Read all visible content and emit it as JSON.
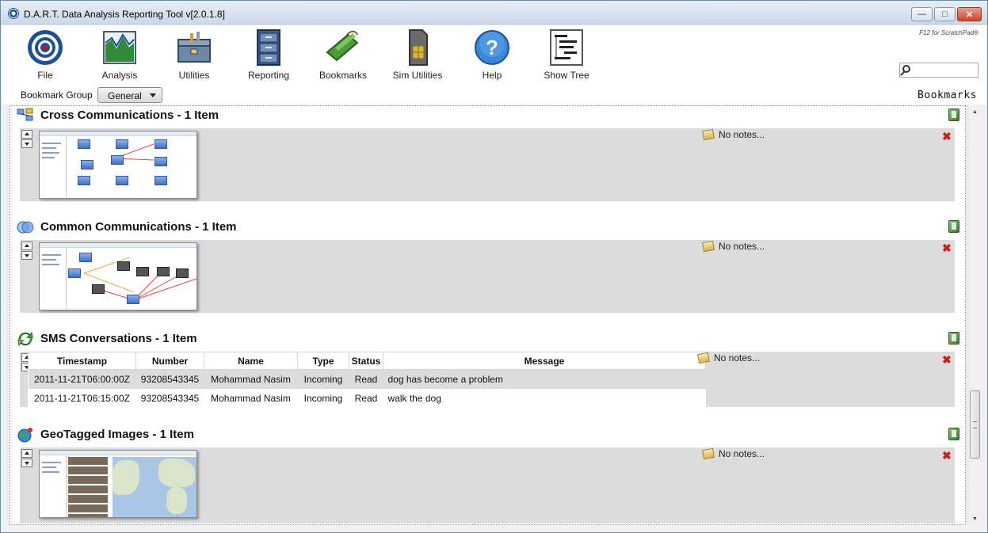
{
  "window": {
    "title": "D.A.R.T. Data Analysis Reporting Tool v[2.0.1.8]",
    "minimize_symbol": "—",
    "maximize_symbol": "□",
    "close_symbol": "✕"
  },
  "toolbar": {
    "items": [
      {
        "label": "File",
        "icon": "file-disc-icon"
      },
      {
        "label": "Analysis",
        "icon": "chart-icon"
      },
      {
        "label": "Utilities",
        "icon": "toolbox-icon"
      },
      {
        "label": "Reporting",
        "icon": "cabinet-icon"
      },
      {
        "label": "Bookmarks",
        "icon": "bookmark-icon"
      },
      {
        "label": "Sim Utilities",
        "icon": "sim-card-icon"
      },
      {
        "label": "Help",
        "icon": "help-icon"
      },
      {
        "label": "Show Tree",
        "icon": "tree-icon"
      }
    ],
    "f12_hint": "F12 for ScratchPad®",
    "search": {
      "value": "",
      "placeholder": ""
    }
  },
  "bookmark_group": {
    "label": "Bookmark Group",
    "selected": "General"
  },
  "panel_heading": "Bookmarks",
  "sections": [
    {
      "title": "Cross Communications - 1 Item",
      "notes": "No notes...",
      "delete_symbol": "✖"
    },
    {
      "title": "Common Communications - 1 Item",
      "notes": "No notes...",
      "delete_symbol": "✖"
    },
    {
      "title": "SMS Conversations - 1 Item",
      "notes": "No notes...",
      "delete_symbol": "✖",
      "table": {
        "columns": [
          "Timestamp",
          "Number",
          "Name",
          "Type",
          "Status",
          "Message"
        ],
        "rows": [
          [
            "2011-11-21T06:00:00Z",
            "93208543345",
            "Mohammad Nasim",
            "Incoming",
            "Read",
            "dog has become a problem"
          ],
          [
            "2011-11-21T06:15:00Z",
            "93208543345",
            "Mohammad Nasim",
            "Incoming",
            "Read",
            "walk the dog"
          ]
        ]
      }
    },
    {
      "title": "GeoTagged Images - 1 Item",
      "notes": "No notes...",
      "delete_symbol": "✖"
    }
  ],
  "colors": {
    "accent_blue": "#1d4f9c",
    "delete_red": "#cc1d12",
    "section_bg": "#dcdcdc"
  }
}
